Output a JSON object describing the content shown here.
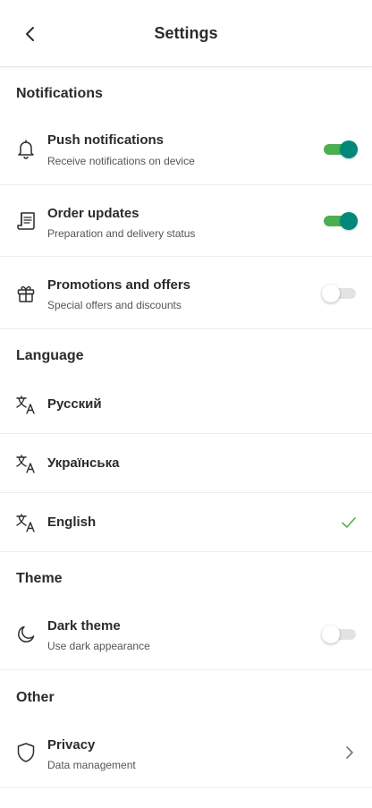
{
  "header": {
    "title": "Settings",
    "back_icon": "chevron-left-icon"
  },
  "sections": {
    "notifications": {
      "title": "Notifications",
      "items": [
        {
          "title": "Push notifications",
          "subtitle": "Receive notifications on device",
          "icon": "bell-icon",
          "enabled": true
        },
        {
          "title": "Order updates",
          "subtitle": "Preparation and delivery status",
          "icon": "receipt-icon",
          "enabled": true
        },
        {
          "title": "Promotions and offers",
          "subtitle": "Special offers and discounts",
          "icon": "gift-icon",
          "enabled": false
        }
      ]
    },
    "language": {
      "title": "Language",
      "items": [
        {
          "title": "Русский",
          "icon": "translate-icon",
          "selected": false
        },
        {
          "title": "Українська",
          "icon": "translate-icon",
          "selected": false
        },
        {
          "title": "English",
          "icon": "translate-icon",
          "selected": true
        }
      ]
    },
    "theme": {
      "title": "Theme",
      "items": [
        {
          "title": "Dark theme",
          "subtitle": "Use dark appearance",
          "icon": "moon-icon",
          "enabled": false
        }
      ]
    },
    "other": {
      "title": "Other",
      "items": [
        {
          "title": "Privacy",
          "subtitle": "Data management",
          "icon": "shield-icon"
        }
      ]
    }
  },
  "colors": {
    "toggle_on_track": "#4caf50",
    "toggle_on_knob": "#00897b",
    "toggle_off_track": "#e3e3e3",
    "check": "#4caf50",
    "text": "#2b2b2b",
    "divider": "#ececec"
  }
}
